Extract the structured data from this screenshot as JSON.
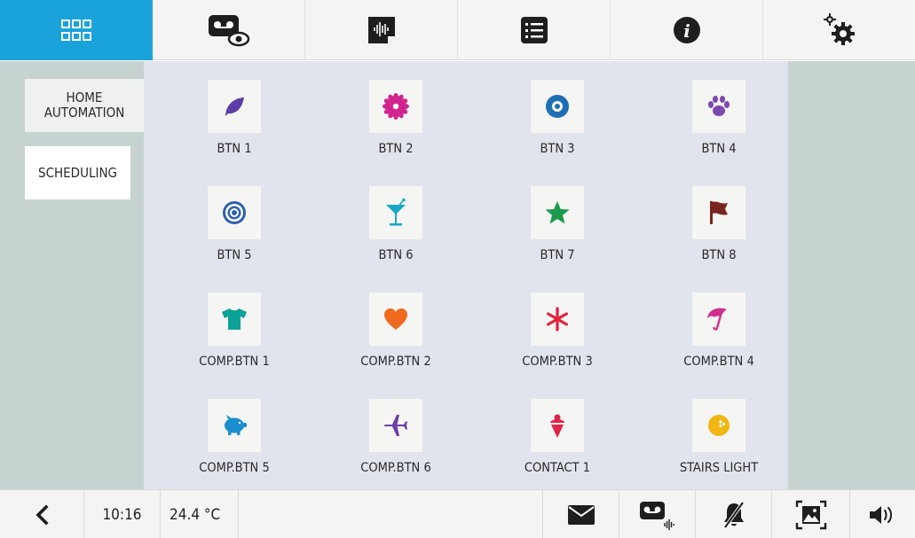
{
  "topbar": {
    "tabs": [
      {
        "icon": "grid-icon"
      },
      {
        "icon": "voicemail-view-icon"
      },
      {
        "icon": "audio-message-icon"
      },
      {
        "icon": "list-icon"
      },
      {
        "icon": "info-icon"
      },
      {
        "icon": "settings-gears-icon"
      }
    ],
    "active_tab": 0
  },
  "sidebar": {
    "home_automation": "HOME\nAUTOMATION",
    "scheduling": "SCHEDULING"
  },
  "grid": {
    "buttons": [
      {
        "label": "BTN 1",
        "icon": "leaf-icon",
        "color": "#5b3fa6"
      },
      {
        "label": "BTN 2",
        "icon": "flower-icon",
        "color": "#d1248f"
      },
      {
        "label": "BTN 3",
        "icon": "donut-icon",
        "color": "#1f6fb6"
      },
      {
        "label": "BTN 4",
        "icon": "paw-icon",
        "color": "#7b49b0"
      },
      {
        "label": "BTN 5",
        "icon": "target-icon",
        "color": "#2d5fb0"
      },
      {
        "label": "BTN 6",
        "icon": "cocktail-icon",
        "color": "#18a9c4"
      },
      {
        "label": "BTN 7",
        "icon": "star-icon",
        "color": "#1a9a4a"
      },
      {
        "label": "BTN 8",
        "icon": "flag-icon",
        "color": "#7a2420"
      },
      {
        "label": "COMP.BTN 1",
        "icon": "tshirt-icon",
        "color": "#0aa196"
      },
      {
        "label": "COMP.BTN 2",
        "icon": "heart-icon",
        "color": "#ef6a1e"
      },
      {
        "label": "COMP.BTN 3",
        "icon": "asterisk-icon",
        "color": "#e0223e"
      },
      {
        "label": "COMP.BTN 4",
        "icon": "umbrella-icon",
        "color": "#d12f8c"
      },
      {
        "label": "COMP.BTN 5",
        "icon": "piggy-bank-icon",
        "color": "#1b8ed0"
      },
      {
        "label": "COMP.BTN 6",
        "icon": "airplane-icon",
        "color": "#6a3fa6"
      },
      {
        "label": "CONTACT 1",
        "icon": "ice-cream-icon",
        "color": "#e0234a"
      },
      {
        "label": "STAIRS LIGHT",
        "icon": "bowling-ball-icon",
        "color": "#f2b614"
      }
    ]
  },
  "bottombar": {
    "time": "10:16",
    "temperature": "24.4 °C",
    "icons": [
      "back-arrow-icon",
      "envelope-icon",
      "voicemail-audio-icon",
      "bell-muted-icon",
      "picture-frame-icon",
      "speaker-icon"
    ]
  }
}
